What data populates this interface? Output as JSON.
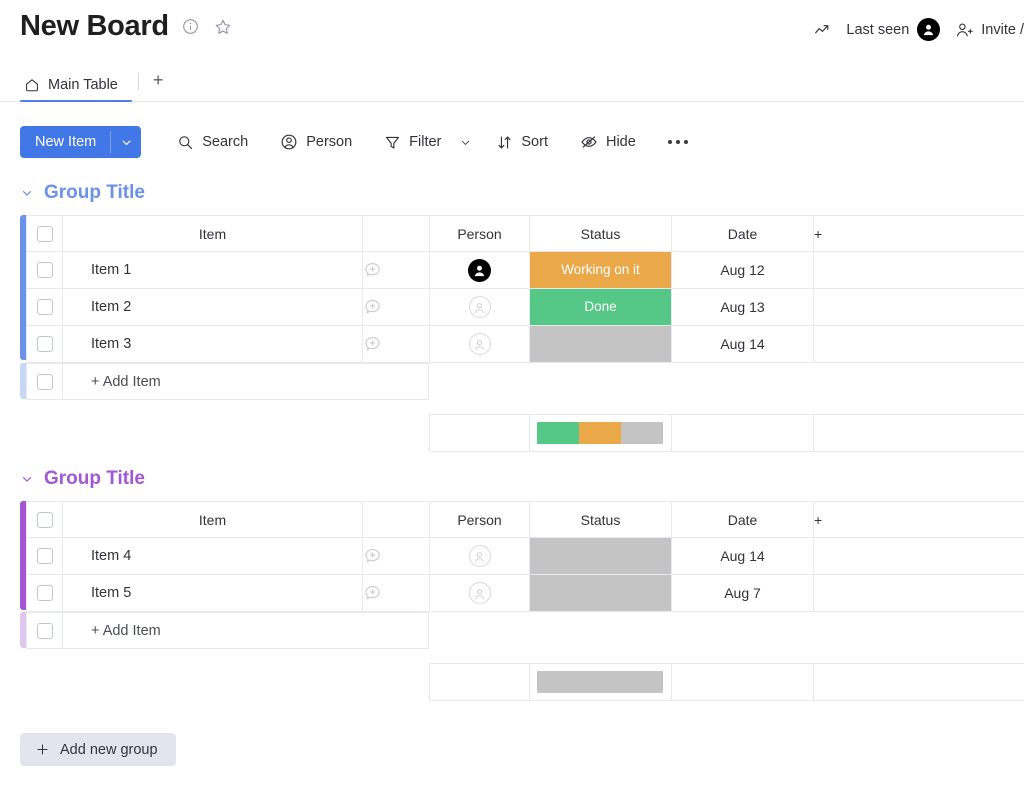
{
  "header": {
    "title": "New Board",
    "info_icon": "info-circle-icon",
    "favorite_icon": "star-icon",
    "activity_icon": "activity-trend-icon",
    "last_seen_label": "Last seen",
    "invite_label": "Invite /"
  },
  "tabs": {
    "items": [
      {
        "label": "Main Table",
        "icon": "home-icon",
        "active": true
      }
    ],
    "add_label": "+"
  },
  "toolbar": {
    "new_item_label": "New Item",
    "new_item_caret": "chevron-down-icon",
    "search_label": "Search",
    "person_label": "Person",
    "filter_label": "Filter",
    "sort_label": "Sort",
    "hide_label": "Hide",
    "more_label": "•••"
  },
  "columns": {
    "item": "Item",
    "person": "Person",
    "status": "Status",
    "date": "Date",
    "add": "+"
  },
  "groups": [
    {
      "title": "Group Title",
      "color": "#6a92e8",
      "add_item_label": "+ Add Item",
      "rows": [
        {
          "name": "Item 1",
          "person": "filled",
          "status": "Working on it",
          "status_color": "#eaa849",
          "date": "Aug 12"
        },
        {
          "name": "Item 2",
          "person": "empty",
          "status": "Done",
          "status_color": "#55c887",
          "date": "Aug 13"
        },
        {
          "name": "Item 3",
          "person": "empty",
          "status": "",
          "status_color": "#c4c4c4",
          "date": "Aug 14"
        }
      ],
      "summary": [
        {
          "color": "#55c887",
          "pct": 33.34
        },
        {
          "color": "#eaa849",
          "pct": 33.33
        },
        {
          "color": "#c4c4c4",
          "pct": 33.33
        }
      ]
    },
    {
      "title": "Group Title",
      "color": "#a356d6",
      "add_item_label": "+ Add Item",
      "rows": [
        {
          "name": "Item 4",
          "person": "empty",
          "status": "",
          "status_color": "#c4c4c4",
          "date": "Aug 14"
        },
        {
          "name": "Item 5",
          "person": "empty",
          "status": "",
          "status_color": "#c4c4c4",
          "date": "Aug 7"
        }
      ],
      "summary": [
        {
          "color": "#c4c4c4",
          "pct": 100
        }
      ]
    }
  ],
  "footer": {
    "add_group_label": "Add new group",
    "add_group_icon": "plus-icon"
  },
  "colors": {
    "accent_blue": "#4277e8",
    "group_blue": "#6a92e8",
    "group_purple": "#a356d6",
    "status_orange": "#eaa849",
    "status_green": "#55c887",
    "status_grey": "#c4c4c4",
    "border": "#e6e9ef"
  }
}
